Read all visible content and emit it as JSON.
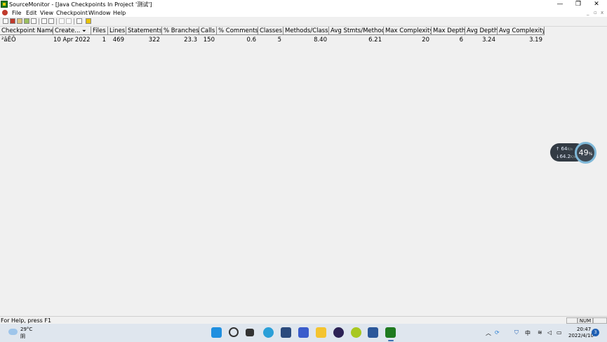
{
  "window": {
    "title": "SourceMonitor - [Java Checkpoints In Project '测试']",
    "controls": {
      "minimize": "—",
      "restore": "❐",
      "close": "✕"
    },
    "mdi_controls": {
      "minimize": "_",
      "restore": "▫",
      "close": "x"
    }
  },
  "menu": [
    "File",
    "Edit",
    "View",
    "Checkpoint",
    "Window",
    "Help"
  ],
  "toolbar_icons": [
    "new-icon",
    "open-icon",
    "project-icon",
    "checkpoint-icon",
    "save-icon",
    "print-icon",
    "print-preview-icon",
    "cut-icon",
    "copy-icon",
    "help-icon",
    "chart-icon"
  ],
  "table": {
    "columns": [
      "Checkpoint Name",
      "Create...",
      "Files",
      "Lines",
      "Statements",
      "% Branches",
      "Calls",
      "% Comments",
      "Classes",
      "Methods/Class",
      "Avg Stmts/Method",
      "Max Complexity",
      "Max Depth",
      "Avg Depth",
      "Avg Complexity"
    ],
    "sorted_column_indicator": "⏷",
    "rows": [
      [
        "²âÊÔ",
        "10 Apr 2022",
        "1",
        "469",
        "322",
        "23.3",
        "150",
        "0.6",
        "5",
        "8.40",
        "6.21",
        "20",
        "6",
        "3.24",
        "3.19"
      ]
    ]
  },
  "status": {
    "text": "For Help, press F1",
    "num": "NUM"
  },
  "net_widget": {
    "up": "64",
    "up_unit": "K/s",
    "down": "64.2",
    "down_unit": "K/s",
    "cpu": "49",
    "cpu_unit": "%"
  },
  "taskbar": {
    "weather_temp": "29°C",
    "weather_cond": "阴",
    "ime": "中",
    "time": "20:47",
    "date": "2022/4/10",
    "notifications": "3",
    "apps": [
      "start-icon",
      "search-icon",
      "task-view-icon",
      "edge-icon",
      "store-icon",
      "vscode-icon",
      "file-explorer-icon",
      "eclipse-icon",
      "java-icon",
      "word-icon",
      "sourcemonitor-icon"
    ]
  }
}
